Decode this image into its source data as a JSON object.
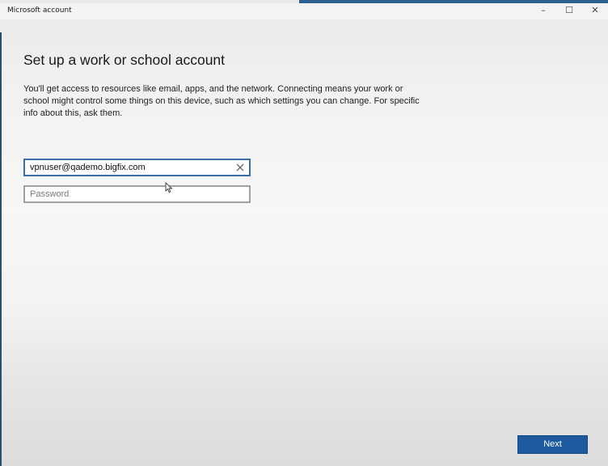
{
  "window": {
    "title": "Microsoft account",
    "controls": {
      "minimize": "–",
      "maximize": "☐",
      "close": "✕"
    }
  },
  "main": {
    "heading": "Set up a work or school account",
    "description": "You'll get access to resources like email, apps, and the network. Connecting means your work or school might control some things on this device, such as which settings you can change. For specific info about this, ask them."
  },
  "form": {
    "email": {
      "value": "vpnuser@qademo.bigfix.com",
      "placeholder": ""
    },
    "password": {
      "value": "",
      "placeholder": "Password"
    },
    "clear_icon": "close-icon"
  },
  "footer": {
    "next_label": "Next"
  },
  "colors": {
    "accent": "#1d5a9e",
    "focus_border": "#3a6ea5",
    "taskbar": "#2f5f8f"
  }
}
